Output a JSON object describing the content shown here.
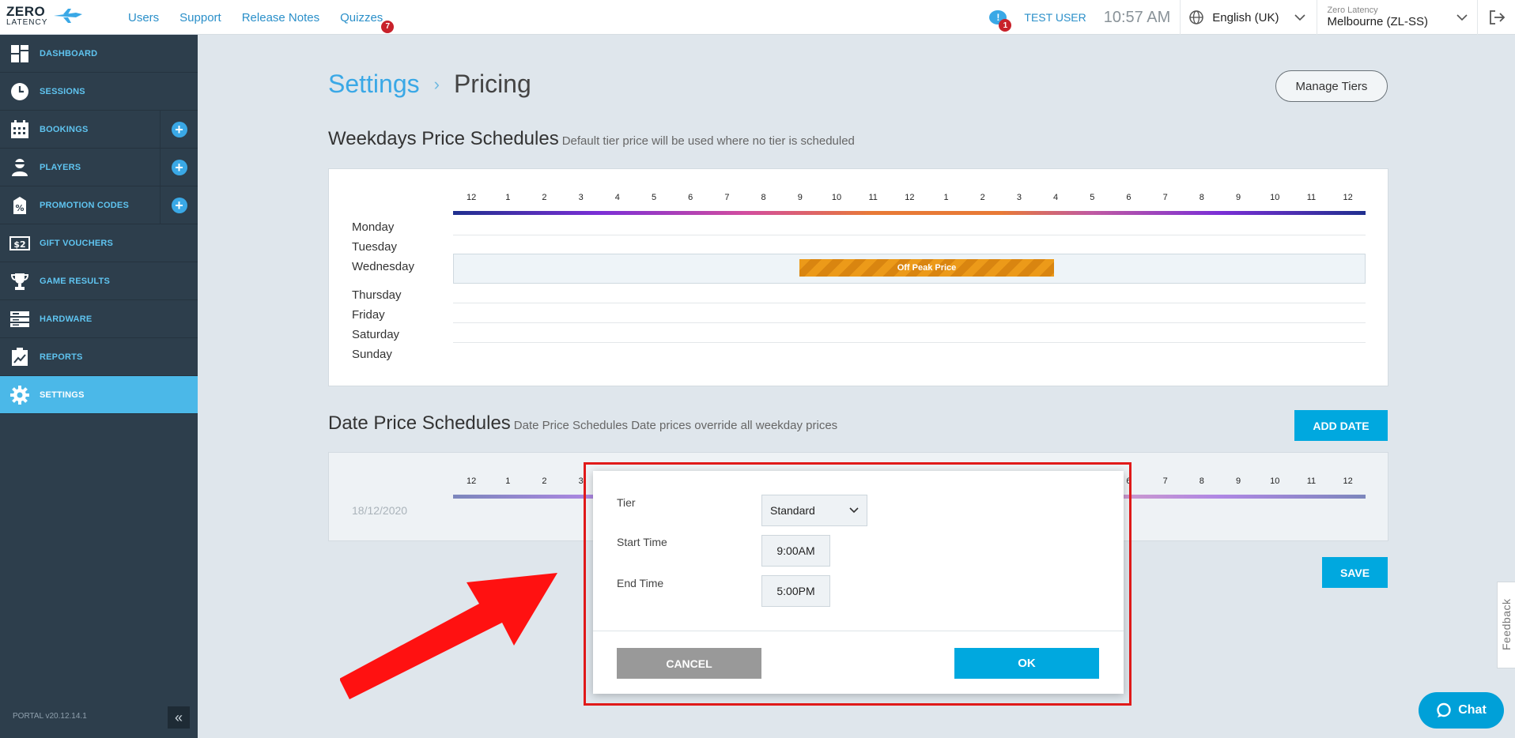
{
  "brand": {
    "logo_top": "ZERO",
    "logo_bottom": "LATENCY"
  },
  "topnav": {
    "links": [
      "Users",
      "Support",
      "Release Notes",
      "Quizzes"
    ],
    "quizzes_badge": "7"
  },
  "topbar": {
    "notification_count": "1",
    "user": "TEST USER",
    "time": "10:57 AM",
    "language": "English (UK)",
    "location_small": "Zero Latency",
    "location": "Melbourne (ZL-SS)"
  },
  "sidebar": {
    "items": [
      {
        "label": "DASHBOARD",
        "icon": "dashboard-icon"
      },
      {
        "label": "SESSIONS",
        "icon": "clock-icon"
      },
      {
        "label": "BOOKINGS",
        "icon": "calendar-icon"
      },
      {
        "label": "PLAYERS",
        "icon": "player-icon"
      },
      {
        "label": "PROMOTION CODES",
        "icon": "percent-tag-icon"
      },
      {
        "label": "GIFT VOUCHERS",
        "icon": "voucher-icon"
      },
      {
        "label": "GAME RESULTS",
        "icon": "trophy-icon"
      },
      {
        "label": "HARDWARE",
        "icon": "server-icon"
      },
      {
        "label": "REPORTS",
        "icon": "report-icon"
      },
      {
        "label": "SETTINGS",
        "icon": "gear-icon"
      }
    ],
    "add_symbol": "+",
    "version": "PORTAL v20.12.14.1",
    "collapse": "«"
  },
  "page": {
    "crumb_parent": "Settings",
    "crumb_sep": "›",
    "crumb_current": "Pricing",
    "manage_tiers": "Manage Tiers"
  },
  "weekdays": {
    "title": "Weekdays Price Schedules",
    "subtitle": "Default tier price will be used where no tier is scheduled",
    "hours": [
      "12",
      "1",
      "2",
      "3",
      "4",
      "5",
      "6",
      "7",
      "8",
      "9",
      "10",
      "11",
      "12",
      "1",
      "2",
      "3",
      "4",
      "5",
      "6",
      "7",
      "8",
      "9",
      "10",
      "11",
      "12"
    ],
    "days": [
      "Monday",
      "Tuesday",
      "Wednesday",
      "Thursday",
      "Friday",
      "Saturday",
      "Sunday"
    ],
    "block_label": "Off Peak Price"
  },
  "dates": {
    "title": "Date Price Schedules",
    "subtitle": "Date Price Schedules Date prices override all weekday prices",
    "add_date": "ADD DATE",
    "date": "18/12/2020",
    "save": "SAVE"
  },
  "modal": {
    "tier_label": "Tier",
    "tier_value": "Standard",
    "start_label": "Start Time",
    "start_value": "9:00AM",
    "end_label": "End Time",
    "end_value": "5:00PM",
    "cancel": "CANCEL",
    "ok": "OK"
  },
  "widgets": {
    "feedback": "Feedback",
    "chat": "Chat"
  },
  "colors": {
    "accent": "#00a8df",
    "sidebar_bg": "#2d3e4c",
    "active": "#4bb8e8",
    "annotation": "#e11a1a",
    "offpeak": "#ec9a19"
  }
}
